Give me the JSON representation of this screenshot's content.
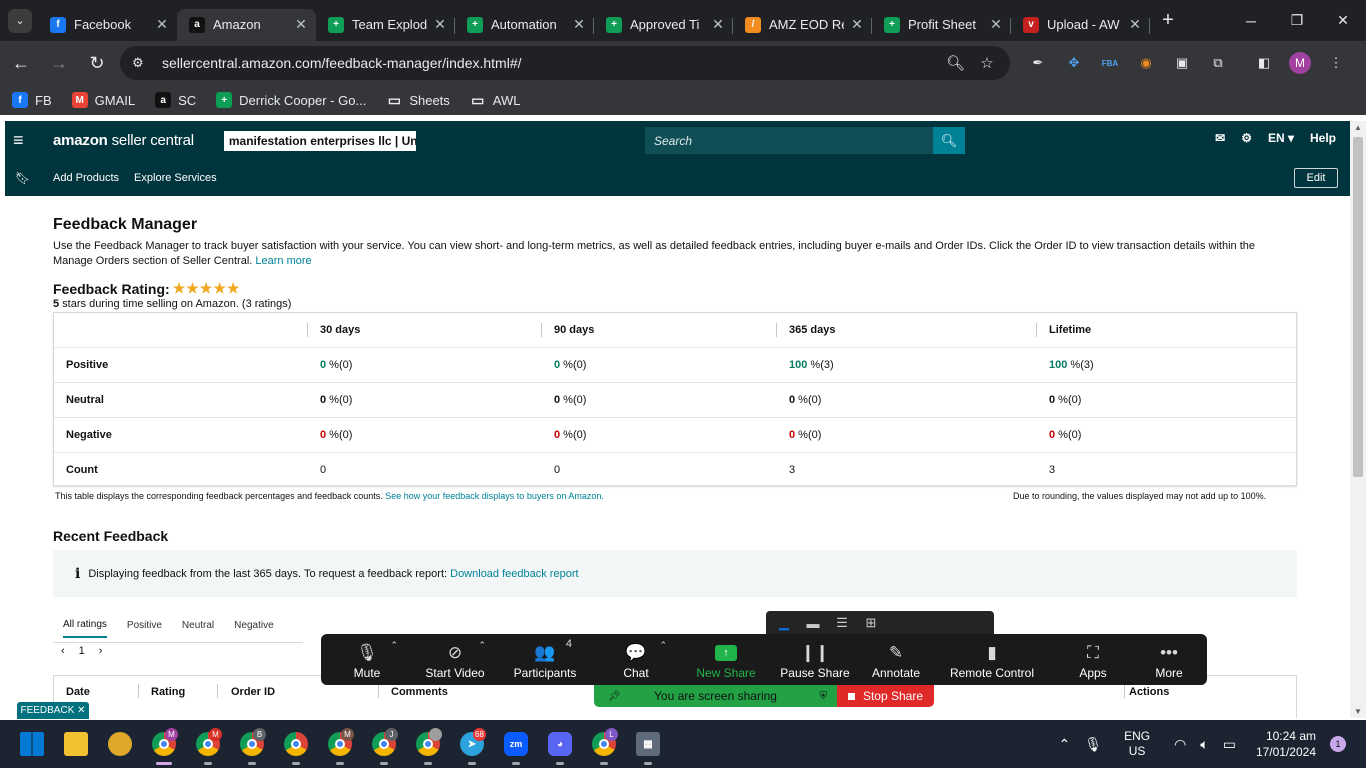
{
  "browser": {
    "tabs": [
      {
        "title": "Facebook",
        "icon": "facebook-icon",
        "color": "#1877f2",
        "glyph": "f"
      },
      {
        "title": "Amazon",
        "icon": "amazon-icon",
        "color": "#111111",
        "glyph": "a"
      },
      {
        "title": "Team Explod",
        "icon": "sheets-icon",
        "color": "#0f9d58",
        "glyph": "+"
      },
      {
        "title": "Automation",
        "icon": "sheets-icon",
        "color": "#0f9d58",
        "glyph": "+"
      },
      {
        "title": "Approved Ti",
        "icon": "sheets-icon",
        "color": "#0f9d58",
        "glyph": "+"
      },
      {
        "title": "AMZ EOD Re",
        "icon": "pencil-app-icon",
        "color": "#f28b20",
        "glyph": "/"
      },
      {
        "title": "Profit Sheet",
        "icon": "sheets-icon",
        "color": "#0f9d58",
        "glyph": "+"
      },
      {
        "title": "Upload - AW",
        "icon": "upload-app-icon",
        "color": "#c5221f",
        "glyph": "v"
      }
    ],
    "url": "sellercentral.amazon.com/feedback-manager/index.html#/",
    "profile_initial": "M",
    "bookmarks": [
      {
        "label": "FB",
        "icon": "facebook-icon",
        "color": "#1877f2",
        "glyph": "f"
      },
      {
        "label": "GMAIL",
        "icon": "gmail-icon",
        "color": "#ea4335",
        "glyph": "M"
      },
      {
        "label": "SC",
        "icon": "amazon-icon",
        "color": "#111111",
        "glyph": "a"
      },
      {
        "label": "Derrick Cooper - Go...",
        "icon": "sheets-icon",
        "color": "#0f9d58",
        "glyph": "+"
      },
      {
        "label": "Sheets",
        "icon": "folder-icon",
        "color": "",
        "glyph": "▭"
      },
      {
        "label": "AWL",
        "icon": "folder-icon",
        "color": "",
        "glyph": "▭"
      }
    ]
  },
  "header": {
    "logo_main": "amazon",
    "logo_sub": " seller central",
    "account": "manifestation enterprises llc | Uni...",
    "search_placeholder": "Search",
    "lang": "EN ▾",
    "help": "Help",
    "sub_links": [
      "Add Products",
      "Explore Services"
    ],
    "edit": "Edit"
  },
  "page": {
    "title": "Feedback Manager",
    "description": "Use the Feedback Manager to track buyer satisfaction with your service. You can view short- and long-term metrics, as well as detailed feedback entries, including buyer e-mails and Order IDs. Click the Order ID to view transaction details within the Manage Orders section of Seller Central.",
    "learn_more": "Learn more",
    "rating_label": "Feedback Rating:",
    "rating_stars": "★★★★★",
    "rating_sub_strong": "5",
    "rating_sub": " stars during time selling on Amazon. (3 ratings)",
    "columns": [
      "30 days",
      "90 days",
      "365 days",
      "Lifetime"
    ],
    "rows": [
      {
        "label": "Positive",
        "tone": "g",
        "cells": [
          {
            "v": "0",
            "c": "(0)"
          },
          {
            "v": "0",
            "c": "(0)"
          },
          {
            "v": "100",
            "c": "(3)"
          },
          {
            "v": "100",
            "c": "(3)"
          }
        ]
      },
      {
        "label": "Neutral",
        "tone": "n",
        "cells": [
          {
            "v": "0",
            "c": "(0)"
          },
          {
            "v": "0",
            "c": "(0)"
          },
          {
            "v": "0",
            "c": "(0)"
          },
          {
            "v": "0",
            "c": "(0)"
          }
        ]
      },
      {
        "label": "Negative",
        "tone": "r",
        "cells": [
          {
            "v": "0",
            "c": "(0)"
          },
          {
            "v": "0",
            "c": "(0)"
          },
          {
            "v": "0",
            "c": "(0)"
          },
          {
            "v": "0",
            "c": "(0)"
          }
        ]
      }
    ],
    "count_label": "Count",
    "counts": [
      "0",
      "0",
      "3",
      "3"
    ],
    "table_note": "This table displays the corresponding feedback percentages and feedback counts.",
    "table_note_link": "See how your feedback displays to buyers on Amazon.",
    "rounding_note": "Due to rounding, the values displayed may not add up to 100%.",
    "recent_title": "Recent Feedback",
    "info_text": "Displaying feedback from the last 365 days. To request a feedback report:",
    "info_link": "Download feedback report",
    "rating_tabs": [
      "All ratings",
      "Positive",
      "Neutral",
      "Negative"
    ],
    "page_number": "1",
    "list_columns": [
      "Date",
      "Rating",
      "Order ID",
      "Comments",
      "Actions"
    ],
    "feedback_tab": "FEEDBACK ✕"
  },
  "zoom": {
    "buttons": [
      {
        "label": "Mute",
        "icon": "microphone-icon",
        "glyph": "🎙",
        "caret": true
      },
      {
        "label": "Start Video",
        "icon": "video-off-icon",
        "glyph": "⊘",
        "caret": true
      },
      {
        "label": "Participants",
        "icon": "participants-icon",
        "glyph": "👥",
        "count": "4"
      },
      {
        "label": "Chat",
        "icon": "chat-icon",
        "glyph": "💬",
        "caret": true
      },
      {
        "label": "New Share",
        "icon": "share-screen-icon",
        "glyph": "↑",
        "green": true
      },
      {
        "label": "Pause Share",
        "icon": "pause-icon",
        "glyph": "❙❙"
      },
      {
        "label": "Annotate",
        "icon": "annotate-pencil-icon",
        "glyph": "✎"
      },
      {
        "label": "Remote Control",
        "icon": "mouse-icon",
        "glyph": "▮"
      },
      {
        "label": "Apps",
        "icon": "apps-icon",
        "glyph": "⛶"
      },
      {
        "label": "More",
        "icon": "more-dots-icon",
        "glyph": "•••"
      }
    ],
    "sharing_text": "You are screen sharing",
    "stop_share": "Stop Share"
  },
  "taskbar": {
    "apps": [
      {
        "name": "windows-start",
        "type": "win"
      },
      {
        "name": "file-explorer",
        "type": "folder"
      },
      {
        "name": "app-duck",
        "type": "duck"
      },
      {
        "name": "chrome-profile-m",
        "type": "chrome",
        "badge": "M",
        "badge_color": "#a142a0",
        "active": true
      },
      {
        "name": "chrome-profile-m2",
        "type": "chrome",
        "badge": "M",
        "badge_color": "#d93025"
      },
      {
        "name": "chrome-profile-b",
        "type": "chrome",
        "badge": "B",
        "badge_color": "#5f6368"
      },
      {
        "name": "chrome",
        "type": "chrome"
      },
      {
        "name": "chrome-profile-photo",
        "type": "chrome",
        "badge": "M",
        "badge_color": "#795548"
      },
      {
        "name": "chrome-profile-j",
        "type": "chrome",
        "badge": "J",
        "badge_color": "#5f6368"
      },
      {
        "name": "chrome-profile-photo2",
        "type": "chrome",
        "badge": "",
        "badge_color": "#9e9e9e"
      },
      {
        "name": "telegram",
        "type": "telegram",
        "badge": "68",
        "badge_color": "#e53935"
      },
      {
        "name": "zoom",
        "type": "zoom"
      },
      {
        "name": "discord",
        "type": "discord"
      },
      {
        "name": "chrome-profile-l",
        "type": "chrome",
        "badge": "L",
        "badge_color": "#7e57c2"
      },
      {
        "name": "calculator",
        "type": "calc"
      }
    ],
    "lang_top": "ENG",
    "lang_bottom": "US",
    "time": "10:24 am",
    "date": "17/01/2024",
    "notifications": "1"
  }
}
